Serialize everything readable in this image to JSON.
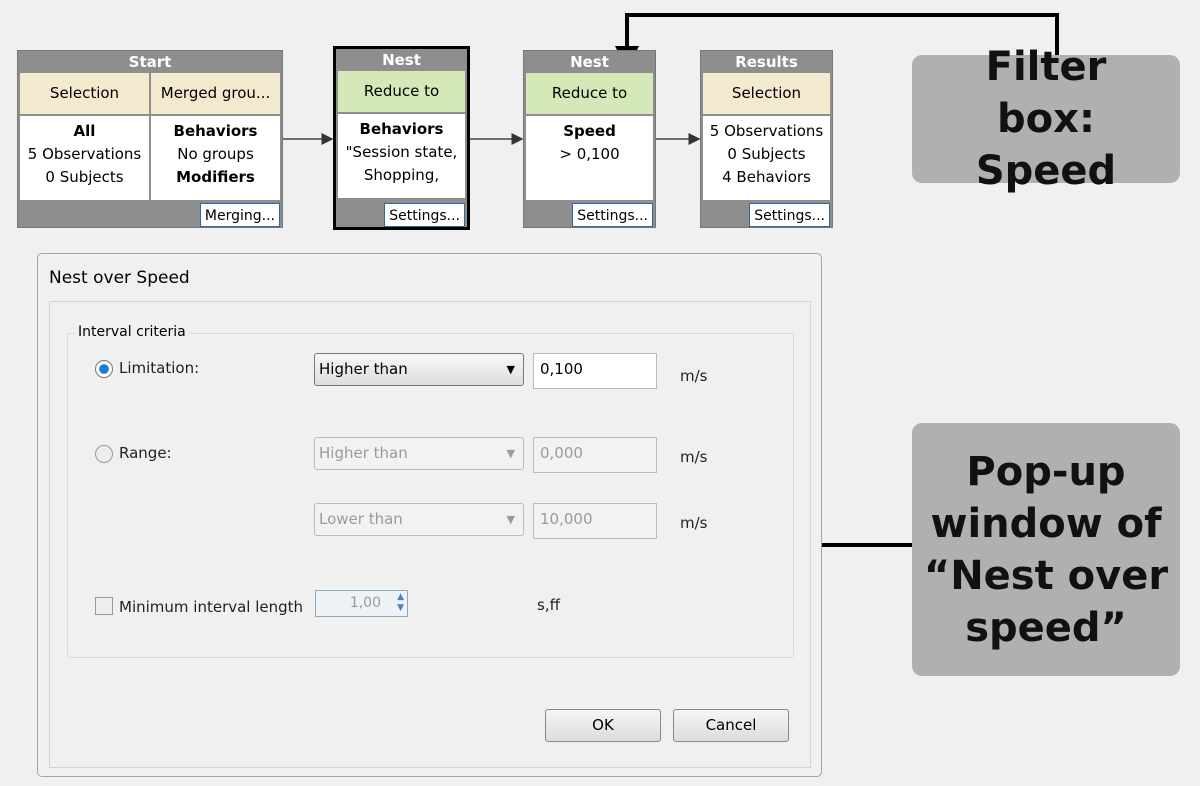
{
  "workflow": {
    "start": {
      "title": "Start",
      "col1": {
        "header": "Selection",
        "lines": [
          "All",
          "5 Observations",
          "0 Subjects"
        ]
      },
      "col2": {
        "header": "Merged grou...",
        "lines": [
          "Behaviors",
          "No groups",
          "Modifiers"
        ]
      },
      "button": "Merging..."
    },
    "nest1": {
      "title": "Nest",
      "header": "Reduce to",
      "lines": [
        "Behaviors",
        "\"Session state,",
        "Shopping,"
      ],
      "button": "Settings..."
    },
    "nest2": {
      "title": "Nest",
      "header": "Reduce to",
      "lines": [
        "Speed",
        "> 0,100"
      ],
      "button": "Settings..."
    },
    "results": {
      "title": "Results",
      "header": "Selection",
      "lines": [
        "5 Observations",
        "0 Subjects",
        "4 Behaviors"
      ],
      "button": "Settings..."
    }
  },
  "callouts": {
    "filter": "Filter box: Speed",
    "popup": "Pop-up window of “Nest over speed”"
  },
  "dialog": {
    "title": "Nest over Speed",
    "group_label": "Interval criteria",
    "limitation": {
      "label": "Limitation:",
      "selected": true,
      "operator": "Higher than",
      "value": "0,100",
      "unit": "m/s"
    },
    "range": {
      "label": "Range:",
      "selected": false,
      "lower_operator": "Higher than",
      "lower_value": "0,000",
      "upper_operator": "Lower than",
      "upper_value": "10,000",
      "unit": "m/s"
    },
    "min_interval": {
      "label": "Minimum interval length",
      "checked": false,
      "value": "1,00",
      "unit": "s,ff"
    },
    "ok": "OK",
    "cancel": "Cancel"
  }
}
